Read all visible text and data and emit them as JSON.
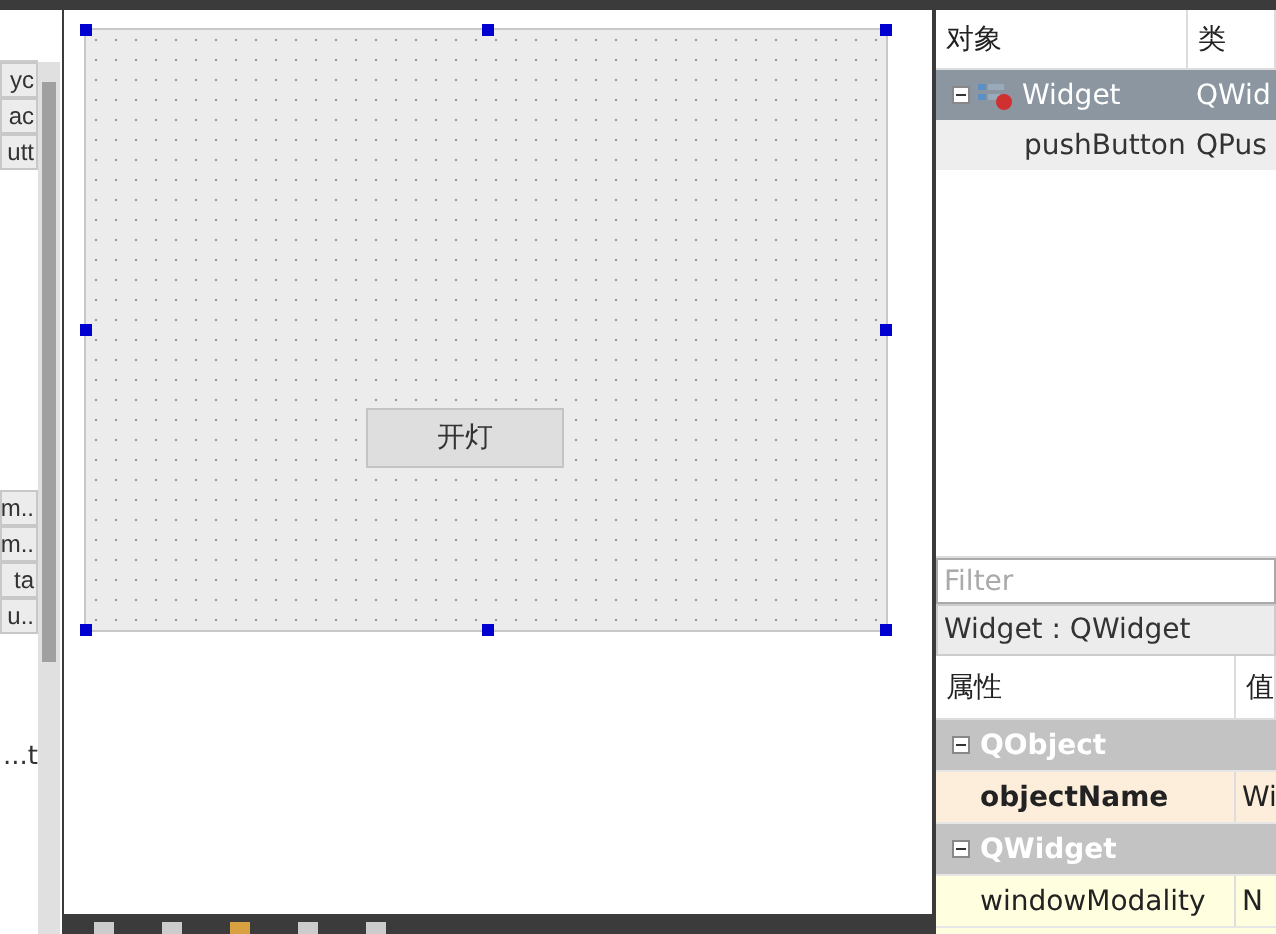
{
  "widget_box": {
    "top_items": [
      "yc",
      "ac",
      "utt"
    ],
    "bottom_items": [
      "m..",
      "m..",
      "ta",
      "u.."
    ],
    "footer_text": "...t"
  },
  "form": {
    "button_label": "开灯"
  },
  "object_inspector": {
    "columns": [
      "对象",
      "类"
    ],
    "rows": [
      {
        "name": "Widget",
        "class": "QWid",
        "selected": true,
        "expanded": true,
        "children": [
          {
            "name": "pushButton",
            "class": "QPus",
            "selected": false
          }
        ]
      }
    ]
  },
  "property_editor": {
    "filter": {
      "placeholder": "Filter"
    },
    "object_label": "Widget : QWidget",
    "columns": [
      "属性",
      "值"
    ],
    "rows": [
      {
        "kind": "group",
        "name": "QObject",
        "expanded": true
      },
      {
        "kind": "property",
        "name": "objectName",
        "value": "Wi",
        "changed": true
      },
      {
        "kind": "group",
        "name": "QWidget",
        "expanded": true
      },
      {
        "kind": "property",
        "name": "windowModality",
        "value": "N",
        "changed": false
      }
    ]
  }
}
